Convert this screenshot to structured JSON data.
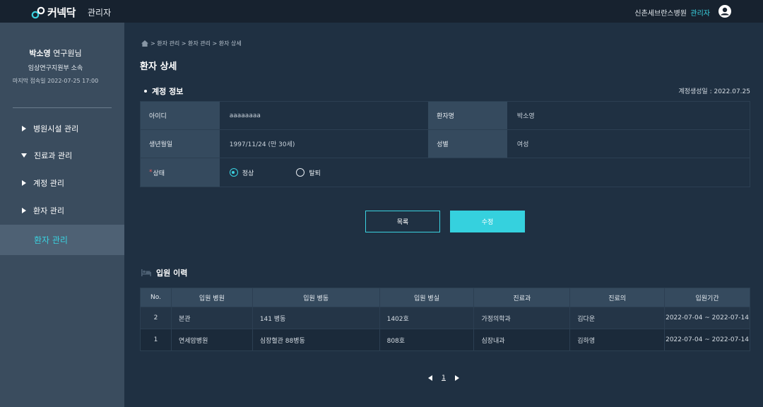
{
  "header": {
    "logo_text": "커넥닥",
    "admin_label": "관리자",
    "hospital": "신촌세브란스병원",
    "role": "관리자"
  },
  "sidebar": {
    "profile": {
      "name": "박소영",
      "title": " 연구원님",
      "dept": "임상연구지원부 소속",
      "last_login": "마지막 접속일 2022-07-25 17:00"
    },
    "items": [
      {
        "label": "병원시설 관리"
      },
      {
        "label": "진료과 관리"
      },
      {
        "label": "계정 관리"
      },
      {
        "label": "환자 관리"
      },
      {
        "label": "환자 관리"
      }
    ]
  },
  "breadcrumb": "> 환자 관리 > 환자 관리 > 환자 상세",
  "page_title": "환자 상세",
  "account": {
    "section_title": "계정 정보",
    "created": "계정생성일 : 2022.07.25",
    "id_label": "아이디",
    "id_value": "aaaaaaaa",
    "name_label": "환자명",
    "name_value": "박소영",
    "birth_label": "생년월일",
    "birth_value": "1997/11/24 (만 30세)",
    "gender_label": "성별",
    "gender_value": "여성",
    "status_required": "*",
    "status_label": "상태",
    "status_options": [
      "정상",
      "탈퇴"
    ],
    "status_selected": "정상"
  },
  "buttons": {
    "list": "목록",
    "edit": "수정"
  },
  "history": {
    "section_title": "입원 이력",
    "columns": [
      "No.",
      "입원 병원",
      "입원 병동",
      "입원 병실",
      "진료과",
      "진료의",
      "입원기간"
    ],
    "rows": [
      [
        "2",
        "본관",
        "141 병동",
        "1402호",
        "가정의학과",
        "김다운",
        "2022-07-04 ~ 2022-07-14"
      ],
      [
        "1",
        "연세암병원",
        "심장혈관 88병동",
        "808호",
        "심장내과",
        "김하영",
        "2022-07-04 ~ 2022-07-14"
      ]
    ]
  },
  "pagination": {
    "current": "1"
  },
  "colors": {
    "accent": "#35d1de",
    "background": "#1f3042",
    "sidebar": "#3a4c5e",
    "topbar": "#17222f"
  }
}
